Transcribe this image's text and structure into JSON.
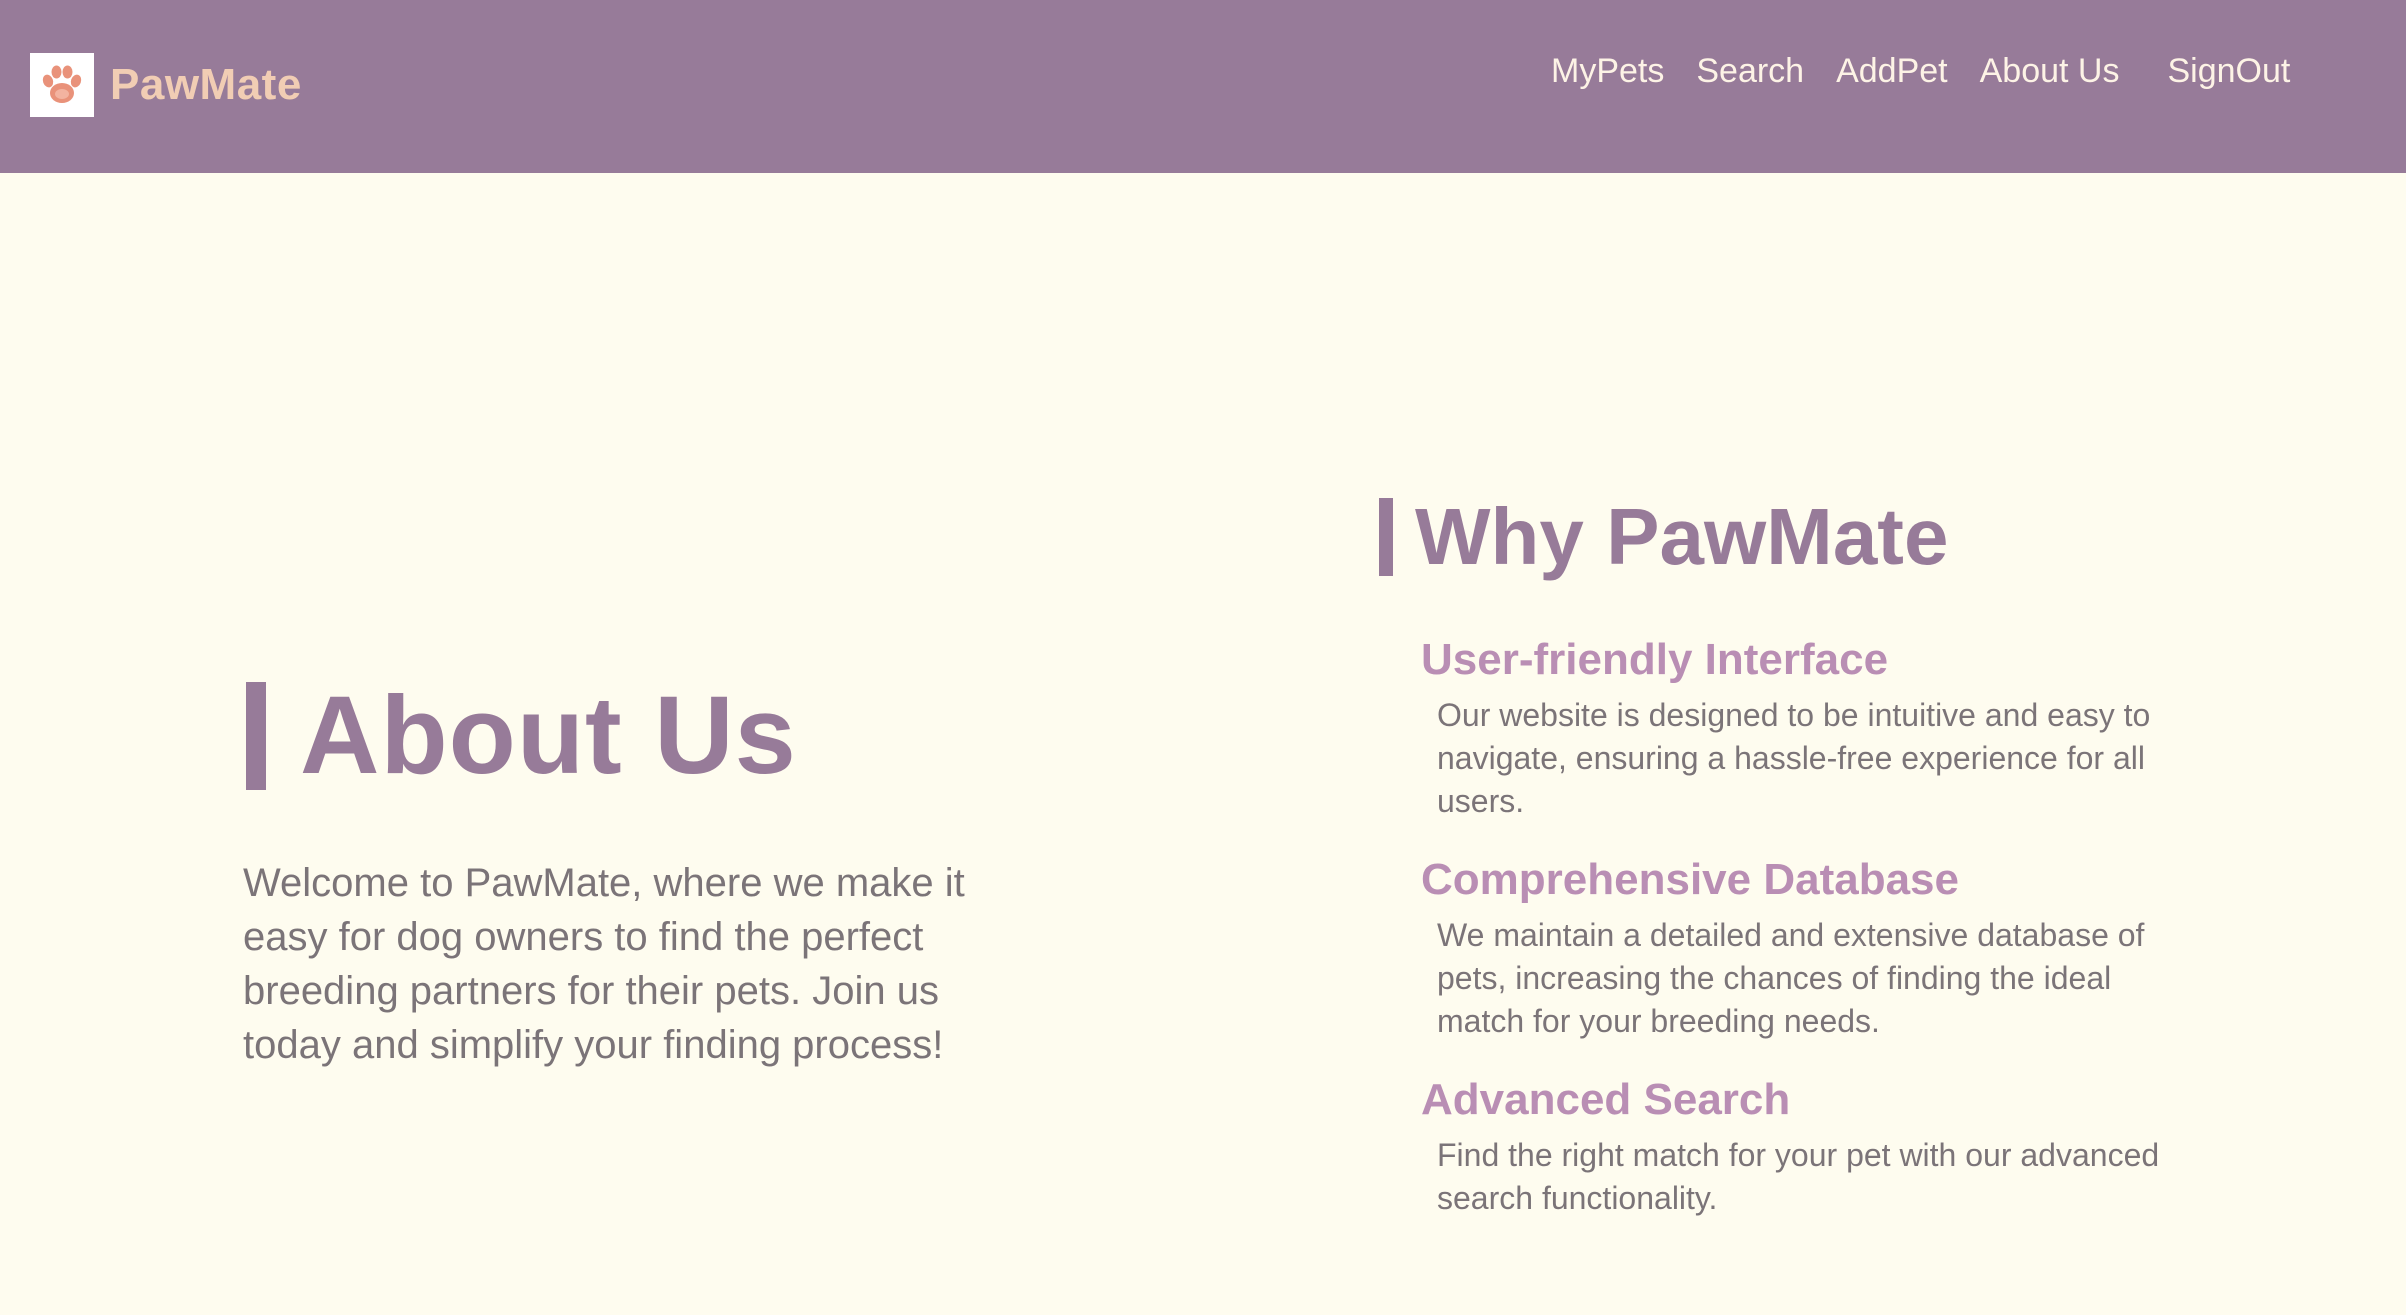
{
  "header": {
    "brand_name": "PawMate",
    "logo_icon": "paw-icon",
    "nav": [
      {
        "label": "MyPets"
      },
      {
        "label": "Search"
      },
      {
        "label": "AddPet"
      },
      {
        "label": "About Us"
      },
      {
        "label": "SignOut"
      }
    ]
  },
  "about": {
    "title": "About Us",
    "text": "Welcome to PawMate, where we make it easy for dog owners to find the perfect breeding partners for their pets. Join us today and simplify your finding process!"
  },
  "why": {
    "title": "Why PawMate",
    "features": [
      {
        "title": "User-friendly Interface",
        "description": "Our website is designed to be intuitive and easy to navigate, ensuring a hassle-free experience for all users."
      },
      {
        "title": "Comprehensive Database",
        "description": "We maintain a detailed and extensive database of pets, increasing the chances of finding the ideal match for your breeding needs."
      },
      {
        "title": "Advanced Search",
        "description": "Find the right match for your pet with our advanced search functionality."
      }
    ]
  },
  "colors": {
    "header_bg": "#977b99",
    "page_bg": "#fefcef",
    "brand_text": "#f1cdb4",
    "heading": "#977b99",
    "feature_title": "#b98eb4",
    "body_text": "#7b7478"
  }
}
